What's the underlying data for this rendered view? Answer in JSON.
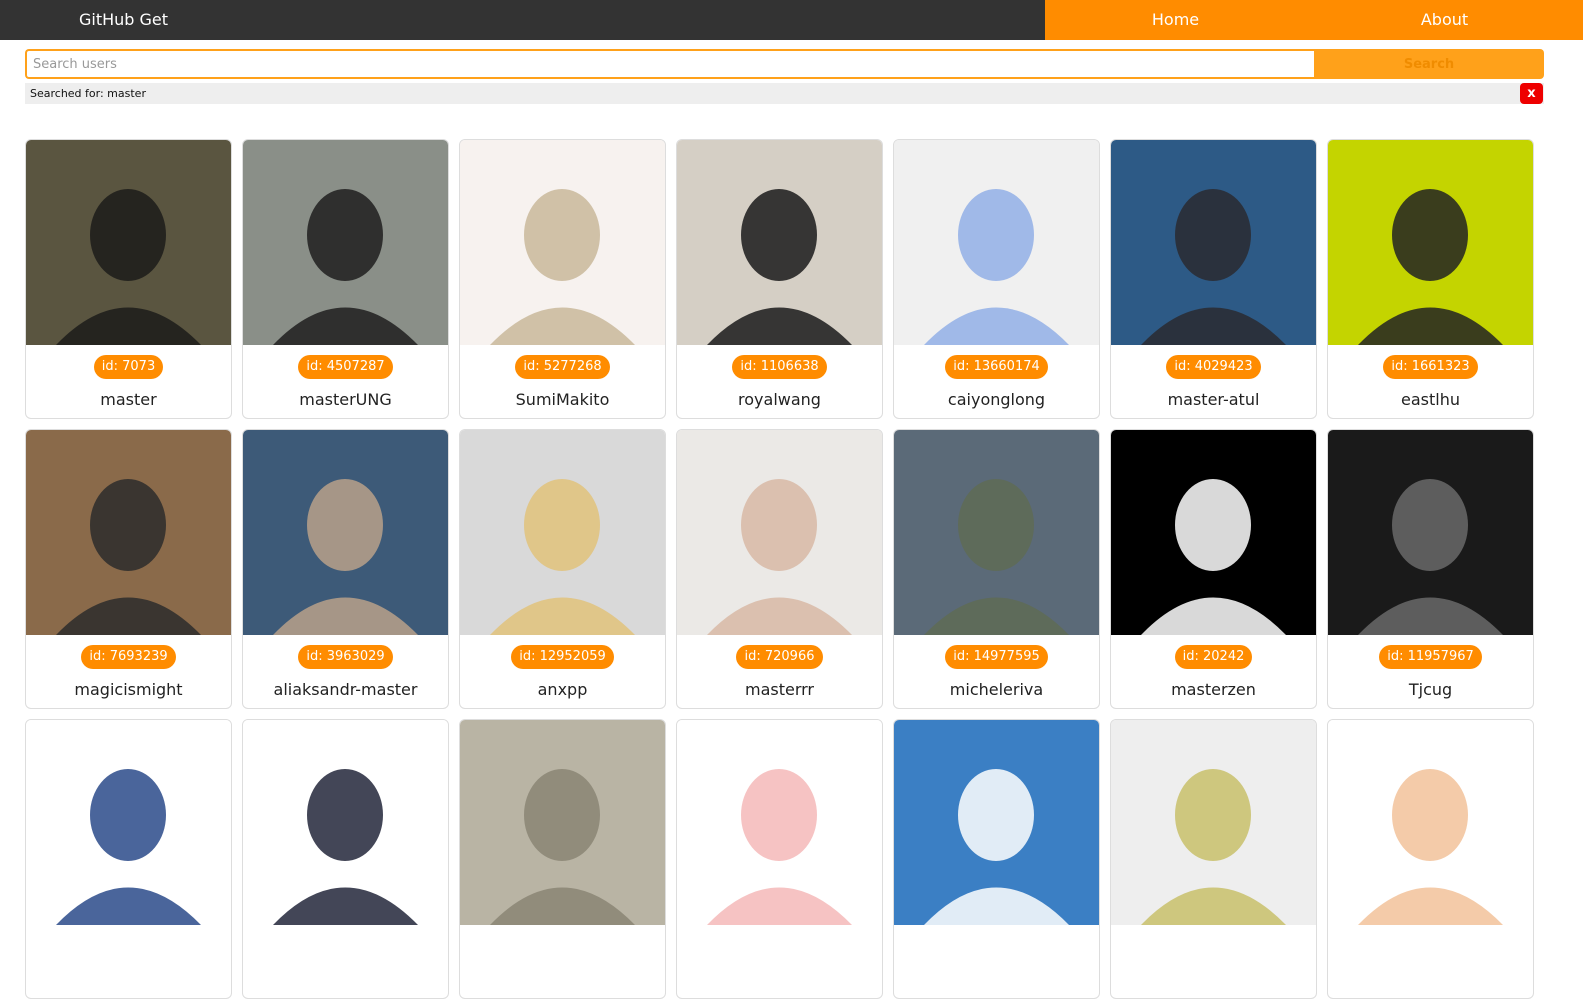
{
  "nav": {
    "brand": "GitHub Get",
    "links": [
      {
        "label": "Home"
      },
      {
        "label": "About"
      }
    ]
  },
  "search": {
    "placeholder": "Search users",
    "value": "",
    "button_label": "Search",
    "status_text": "Searched for: master",
    "clear_label": "x"
  },
  "colors": {
    "accent": "#ff8c00",
    "navbar": "#333333",
    "clear": "#ee0000"
  },
  "users": [
    {
      "id_text": "id: 7073",
      "login": "master",
      "bg": "#5a5540",
      "fg": "#1c1c1a"
    },
    {
      "id_text": "id: 4507287",
      "login": "masterUNG",
      "bg": "#8a8f88",
      "fg": "#1f1f1f"
    },
    {
      "id_text": "id: 5277268",
      "login": "SumiMakito",
      "bg": "#f7f2ef",
      "fg": "#c9b89a"
    },
    {
      "id_text": "id: 1106638",
      "login": "royalwang",
      "bg": "#d5cfc5",
      "fg": "#1a1a1a"
    },
    {
      "id_text": "id: 13660174",
      "login": "caiyonglong",
      "bg": "#f0f0f0",
      "fg": "#92afe6"
    },
    {
      "id_text": "id: 4029423",
      "login": "master-atul",
      "bg": "#2d5a86",
      "fg": "#2a2a30"
    },
    {
      "id_text": "id: 1661323",
      "login": "eastlhu",
      "bg": "#c4d400",
      "fg": "#222222"
    },
    {
      "id_text": "id: 7693239",
      "login": "magicismight",
      "bg": "#8a6a4a",
      "fg": "#2b2b2b"
    },
    {
      "id_text": "id: 3963029",
      "login": "aliaksandr-master",
      "bg": "#3d5a78",
      "fg": "#b9a189"
    },
    {
      "id_text": "id: 12952059",
      "login": "anxpp",
      "bg": "#d9d9d9",
      "fg": "#e0c27a"
    },
    {
      "id_text": "id: 720966",
      "login": "masterrr",
      "bg": "#ebe9e6",
      "fg": "#d8b8a4"
    },
    {
      "id_text": "id: 14977595",
      "login": "micheleriva",
      "bg": "#5b6a78",
      "fg": "#5f6b55"
    },
    {
      "id_text": "id: 20242",
      "login": "masterzen",
      "bg": "#000000",
      "fg": "#ffffff"
    },
    {
      "id_text": "id: 11957967",
      "login": "Tjcug",
      "bg": "#1a1a1a",
      "fg": "#6a6a6a"
    },
    {
      "id_text": "",
      "login": "",
      "bg": "#ffffff",
      "fg": "#2a4a8a"
    },
    {
      "id_text": "",
      "login": "",
      "bg": "#ffffff",
      "fg": "#22263a"
    },
    {
      "id_text": "",
      "login": "",
      "bg": "#b9b4a4",
      "fg": "#8a8574"
    },
    {
      "id_text": "",
      "login": "",
      "bg": "#ffffff",
      "fg": "#f4b8b8"
    },
    {
      "id_text": "",
      "login": "",
      "bg": "#3b7fc4",
      "fg": "#ffffff"
    },
    {
      "id_text": "",
      "login": "",
      "bg": "#eeeeee",
      "fg": "#c8bf6a"
    },
    {
      "id_text": "",
      "login": "",
      "bg": "#ffffff",
      "fg": "#f2c29a"
    }
  ]
}
